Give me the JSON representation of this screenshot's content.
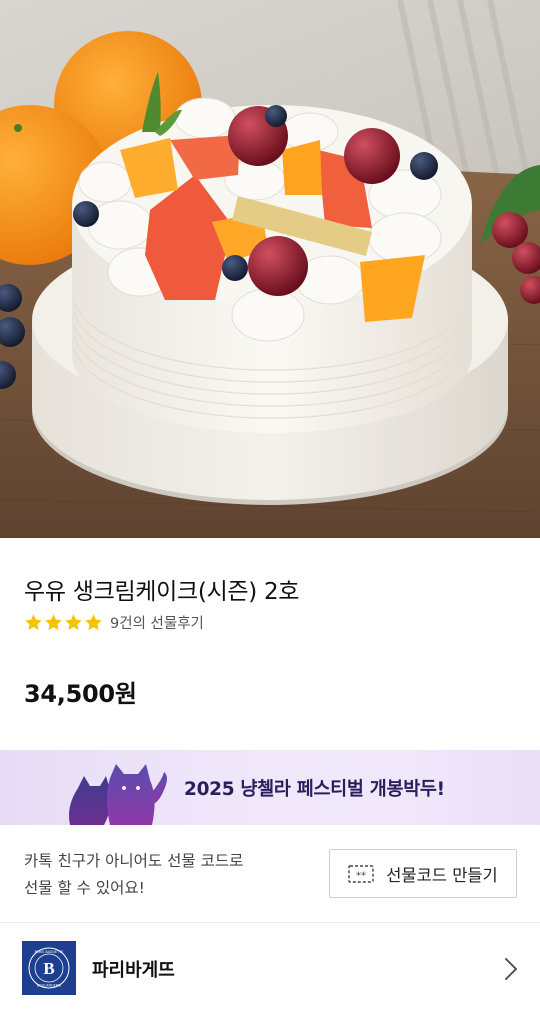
{
  "product": {
    "title": "우유 생크림케이크(시즌) 2호",
    "rating_stars": 4,
    "review_text": "9건의 선물후기",
    "price": "34,500원"
  },
  "promo": {
    "text": "2025 냥첼라 페스티벌 개봉박두!"
  },
  "gift_code": {
    "desc_line1": "카톡 친구가 아니어도 선물 코드로",
    "desc_line2": "선물 할 수 있어요!",
    "button_label": "선물코드 만들기",
    "button_icon": "code-ticket-icon"
  },
  "brand": {
    "name": "파리바게뜨",
    "logo": "paris-baguette-logo"
  },
  "colors": {
    "star": "#f5c400",
    "brand_logo": "#1d3f8f",
    "promo_text": "#2a1f5c"
  }
}
